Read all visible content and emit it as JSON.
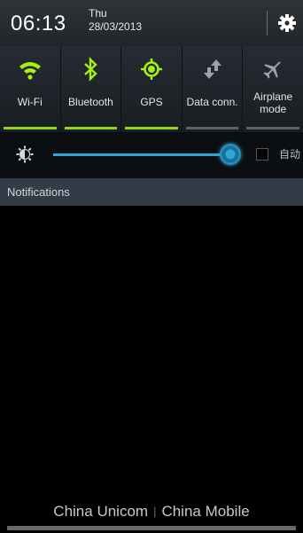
{
  "header": {
    "time": "06:13",
    "day": "Thu",
    "date": "28/03/2013",
    "settings_icon": "gear-icon"
  },
  "toggles": [
    {
      "label": "Wi-Fi",
      "icon": "wifi-icon",
      "on": true
    },
    {
      "label": "Bluetooth",
      "icon": "bluetooth-icon",
      "on": true
    },
    {
      "label": "GPS",
      "icon": "gps-icon",
      "on": true
    },
    {
      "label": "Data conn.",
      "icon": "data-connection-icon",
      "on": false
    },
    {
      "label": "Airplane\nmode",
      "icon": "airplane-icon",
      "on": false
    }
  ],
  "brightness": {
    "level_percent": 100,
    "auto_label": "自动",
    "auto_checked": false,
    "icon": "brightness-icon"
  },
  "notifications": {
    "title": "Notifications"
  },
  "footer": {
    "carrier_1": "China Unicom",
    "separator": "|",
    "carrier_2": "China Mobile"
  },
  "colors": {
    "accent_on": "#8ed51c",
    "accent_off": "#59636d",
    "slider_blue": "#2fa6d8",
    "toggle_icon_on": "#a6f20c",
    "toggle_icon_off": "#9aa3ab"
  }
}
